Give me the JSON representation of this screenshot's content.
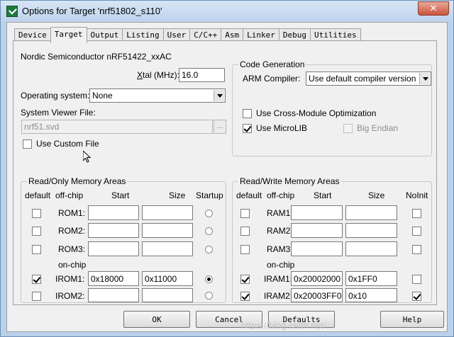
{
  "window": {
    "title": "Options for Target 'nrf51802_s110'",
    "close_glyph": "✕"
  },
  "tabs": [
    {
      "label": "Device"
    },
    {
      "label": "Target"
    },
    {
      "label": "Output"
    },
    {
      "label": "Listing"
    },
    {
      "label": "User"
    },
    {
      "label": "C/C++"
    },
    {
      "label": "Asm"
    },
    {
      "label": "Linker"
    },
    {
      "label": "Debug"
    },
    {
      "label": "Utilities"
    }
  ],
  "active_tab": "Target",
  "device_name": "Nordic Semiconductor nRF51422_xxAC",
  "xtal": {
    "label_prefix": "X",
    "label_rest": "tal (MHz):",
    "value": "16.0"
  },
  "os": {
    "label": "Operating system:",
    "value": "None"
  },
  "svd": {
    "label": "System Viewer File:",
    "value": "nrf51.svd",
    "browse": "..."
  },
  "custom_file": {
    "label": "Use Custom File",
    "checked": false
  },
  "codegen": {
    "title": "Code Generation",
    "compiler_label": "ARM Compiler:",
    "compiler_value": "Use default compiler version",
    "cross_module": {
      "label": "Use Cross-Module Optimization",
      "checked": false
    },
    "microlib": {
      "label": "Use MicroLIB",
      "checked": true
    },
    "big_endian": {
      "label": "Big Endian",
      "checked": false,
      "disabled": true
    }
  },
  "rom": {
    "title": "Read/Only Memory Areas",
    "headers": {
      "default": "default",
      "offchip": "off-chip",
      "start": "Start",
      "size": "Size",
      "startup": "Startup"
    },
    "onchip_label": "on-chip",
    "rows": [
      {
        "name": "ROM1:",
        "default": false,
        "start": "",
        "size": "",
        "selected": false
      },
      {
        "name": "ROM2:",
        "default": false,
        "start": "",
        "size": "",
        "selected": false
      },
      {
        "name": "ROM3:",
        "default": false,
        "start": "",
        "size": "",
        "selected": false
      },
      {
        "name": "IROM1:",
        "default": true,
        "start": "0x18000",
        "size": "0x11000",
        "selected": true
      },
      {
        "name": "IROM2:",
        "default": false,
        "start": "",
        "size": "",
        "selected": false
      }
    ]
  },
  "ram": {
    "title": "Read/Write Memory Areas",
    "headers": {
      "default": "default",
      "offchip": "off-chip",
      "start": "Start",
      "size": "Size",
      "noinit": "NoInit"
    },
    "onchip_label": "on-chip",
    "rows": [
      {
        "name": "RAM1:",
        "default": false,
        "start": "",
        "size": "",
        "noinit": false
      },
      {
        "name": "RAM2:",
        "default": false,
        "start": "",
        "size": "",
        "noinit": false
      },
      {
        "name": "RAM3:",
        "default": false,
        "start": "",
        "size": "",
        "noinit": false
      },
      {
        "name": "IRAM1:",
        "default": true,
        "start": "0x20002000",
        "size": "0x1FF0",
        "noinit": false
      },
      {
        "name": "IRAM2:",
        "default": true,
        "start": "0x20003FF0",
        "size": "0x10",
        "noinit": true
      }
    ]
  },
  "buttons": {
    "ok": "OK",
    "cancel": "Cancel",
    "defaults": "Defaults",
    "help": "Help"
  },
  "watermark": "https://blog.csdn.net/..."
}
